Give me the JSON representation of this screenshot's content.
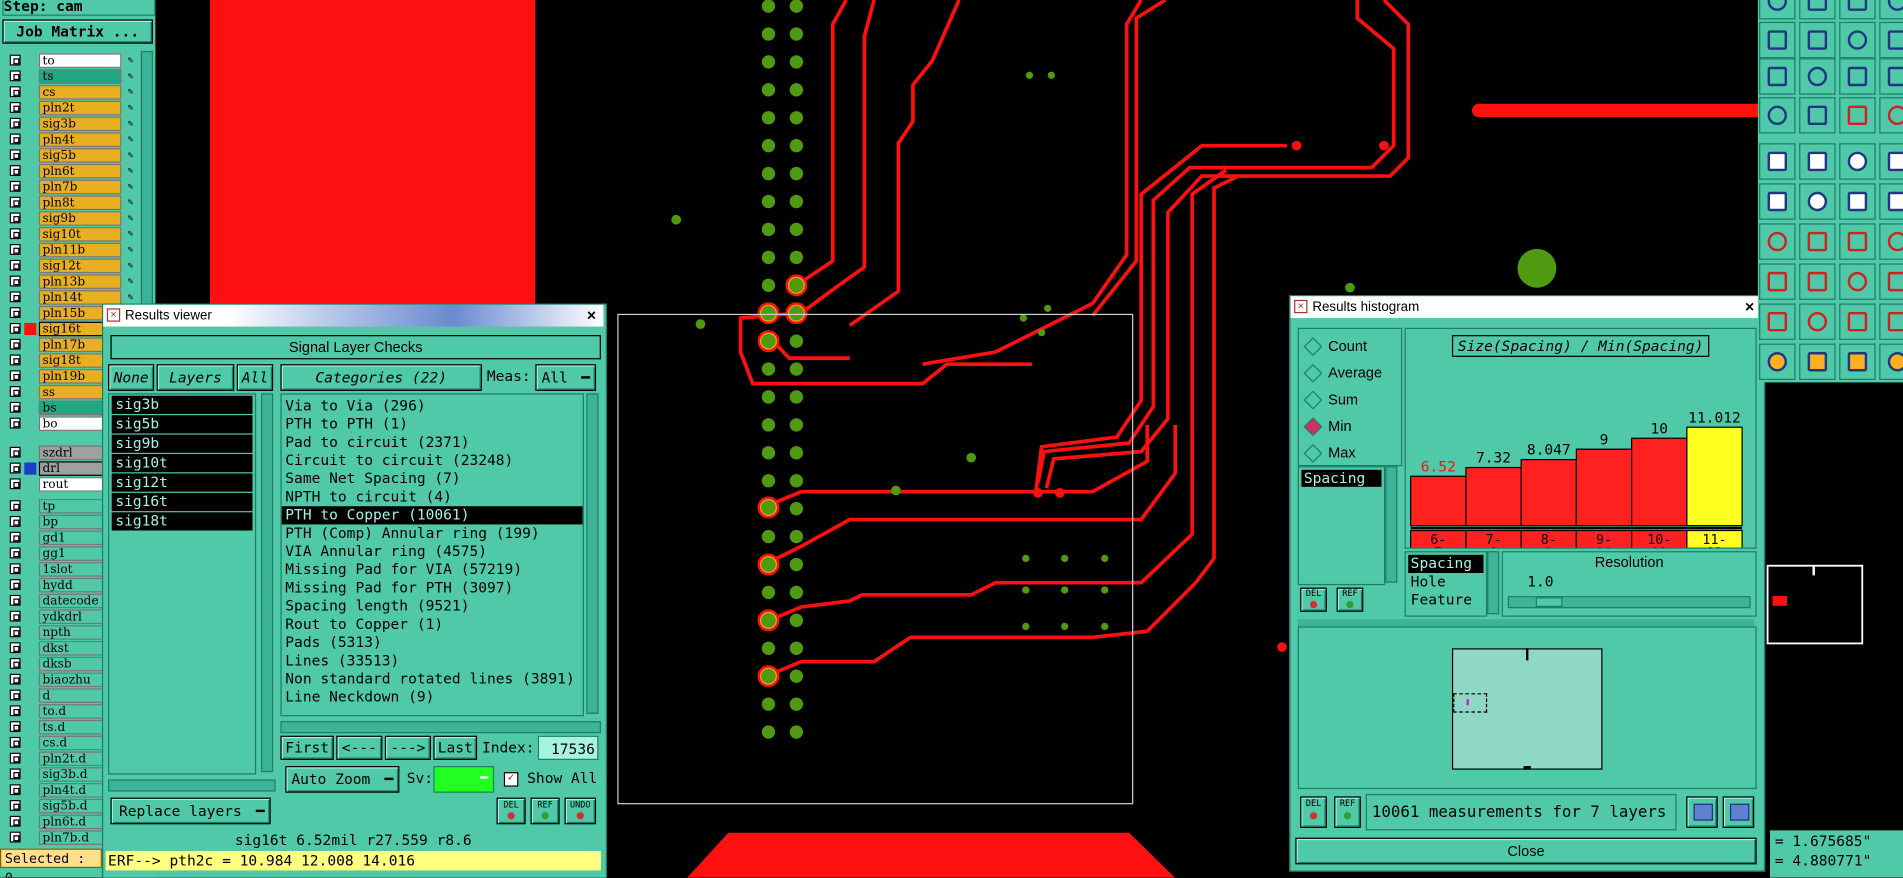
{
  "left_panel": {
    "step_label": "Step: cam",
    "job_matrix_label": "Job Matrix ...",
    "signal_layers": [
      {
        "name": "to",
        "color": "#ffffff"
      },
      {
        "name": "ts",
        "color": "#1fa882"
      },
      {
        "name": "cs",
        "color": "#e8b020"
      },
      {
        "name": "pln2t",
        "color": "#e8b020"
      },
      {
        "name": "sig3b",
        "color": "#e8b020"
      },
      {
        "name": "pln4t",
        "color": "#e8b020"
      },
      {
        "name": "sig5b",
        "color": "#e8b020"
      },
      {
        "name": "pln6t",
        "color": "#e8b020"
      },
      {
        "name": "pln7b",
        "color": "#e8b020"
      },
      {
        "name": "pln8t",
        "color": "#e8b020"
      },
      {
        "name": "sig9b",
        "color": "#e8b020"
      },
      {
        "name": "sig10t",
        "color": "#e8b020"
      },
      {
        "name": "pln11b",
        "color": "#e8b020"
      },
      {
        "name": "sig12t",
        "color": "#e8b020"
      },
      {
        "name": "pln13b",
        "color": "#e8b020"
      },
      {
        "name": "pln14t",
        "color": "#e8b020"
      },
      {
        "name": "pln15b",
        "color": "#e8b020"
      },
      {
        "name": "sig16t",
        "color": "#e8b020",
        "active": true
      },
      {
        "name": "pln17b",
        "color": "#e8b020"
      },
      {
        "name": "sig18t",
        "color": "#e8b020"
      },
      {
        "name": "pln19b",
        "color": "#e8b020"
      },
      {
        "name": "ss",
        "color": "#e8b020"
      },
      {
        "name": "bs",
        "color": "#1fa882"
      },
      {
        "name": "bo",
        "color": "#ffffff"
      }
    ],
    "drill_layers": [
      {
        "name": "szdrl",
        "color": "#a0a0a0"
      },
      {
        "name": "drl",
        "color": "#a0a0a0",
        "active": true
      },
      {
        "name": "rout",
        "color": "#ffffff"
      }
    ],
    "misc_layers": [
      "tp",
      "bp",
      "gd1",
      "gg1",
      "1slot",
      "hydd",
      "datecode",
      "ydkdrl",
      "npth",
      "dkst",
      "dksb",
      "biaozhu",
      "d",
      "to.d",
      "ts.d",
      "cs.d",
      "pln2t.d",
      "sig3b.d",
      "pln4t.d",
      "sig5b.d",
      "pln6t.d",
      "pln7b.d"
    ],
    "selected_label": "Selected : 0"
  },
  "results_viewer": {
    "title": "Results viewer",
    "section_title": "Signal Layer Checks",
    "none_label": "None",
    "layers_label": "Layers",
    "all_label": "All",
    "categories_label": "Categories (22)",
    "meas_label": "Meas:",
    "meas_value": "All",
    "layers": [
      "sig3b",
      "sig5b",
      "sig9b",
      "sig10t",
      "sig12t",
      "sig16t",
      "sig18t"
    ],
    "categories": [
      "Via to Via (296)",
      "PTH to PTH (1)",
      "Pad to circuit (2371)",
      "Circuit to circuit (23248)",
      "Same Net Spacing (7)",
      "NPTH to circuit (4)",
      "PTH to Copper (10061)",
      "PTH (Comp) Annular ring (199)",
      "VIA Annular ring (4575)",
      "Missing Pad for VIA (57219)",
      "Missing Pad for PTH (3097)",
      "Spacing length (9521)",
      "Rout to Copper (1)",
      "Pads (5313)",
      "Lines (33513)",
      "Non standard rotated lines (3891)",
      "Line Neckdown (9)"
    ],
    "selected_category_index": 6,
    "first_label": "First",
    "prev_label": "<---",
    "next_label": "--->",
    "last_label": "Last",
    "index_label": "Index:",
    "index_value": "17536",
    "auto_zoom_label": "Auto Zoom",
    "sv_label": "Sv:",
    "show_all_label": "Show All",
    "replace_layers_label": "Replace layers",
    "del_label": "DEL",
    "ref_label": "REF",
    "undo_label": "UNDO",
    "status_line": "sig16t 6.52mil  r27.559  r8.6",
    "erf_line": "ERF--> pth2c = 10.984 12.008 14.016"
  },
  "histogram": {
    "title": "Results histogram",
    "modes": [
      "Count",
      "Average",
      "Sum",
      "Min",
      "Max"
    ],
    "selected_mode": "Min",
    "spacing_label": "Spacing",
    "chart_title": "Size(Spacing) / Min(Spacing)",
    "types": [
      "Spacing",
      "Hole",
      "Feature"
    ],
    "resolution_label": "Resolution",
    "resolution_value": "1.0",
    "summary": "10061 measurements for 7 layers",
    "close_label": "Close",
    "del_label": "DEL",
    "ref_label": "REF"
  },
  "chart_data": {
    "type": "bar",
    "title": "Size(Spacing) / Min(Spacing)",
    "categories": [
      "6-7",
      "7-8",
      "8-9",
      "9-10",
      "10-11",
      "11-12"
    ],
    "category_lines": [
      [
        "6-",
        "7"
      ],
      [
        "7-",
        "8"
      ],
      [
        "8-",
        "9"
      ],
      [
        "9-",
        "10"
      ],
      [
        "10-",
        "11"
      ],
      [
        "11-",
        "12"
      ]
    ],
    "values": [
      6.52,
      7.32,
      8.047,
      9,
      10,
      11.012
    ],
    "value_labels": [
      "6.52",
      "7.32",
      "8.047",
      "9",
      "10",
      "11.012"
    ],
    "bar_colors": [
      "#ff2020",
      "#ff2020",
      "#ff2020",
      "#ff2020",
      "#ff2020",
      "#ffff20"
    ],
    "highlight_index": 0
  },
  "coords": {
    "x": "1.675685\"",
    "y": "4.880771\""
  },
  "colors": {
    "panel": "#4fc9a8",
    "trace": "#ff1010",
    "pad": "#4f9a10",
    "highlight_pad": "#ffa020"
  }
}
